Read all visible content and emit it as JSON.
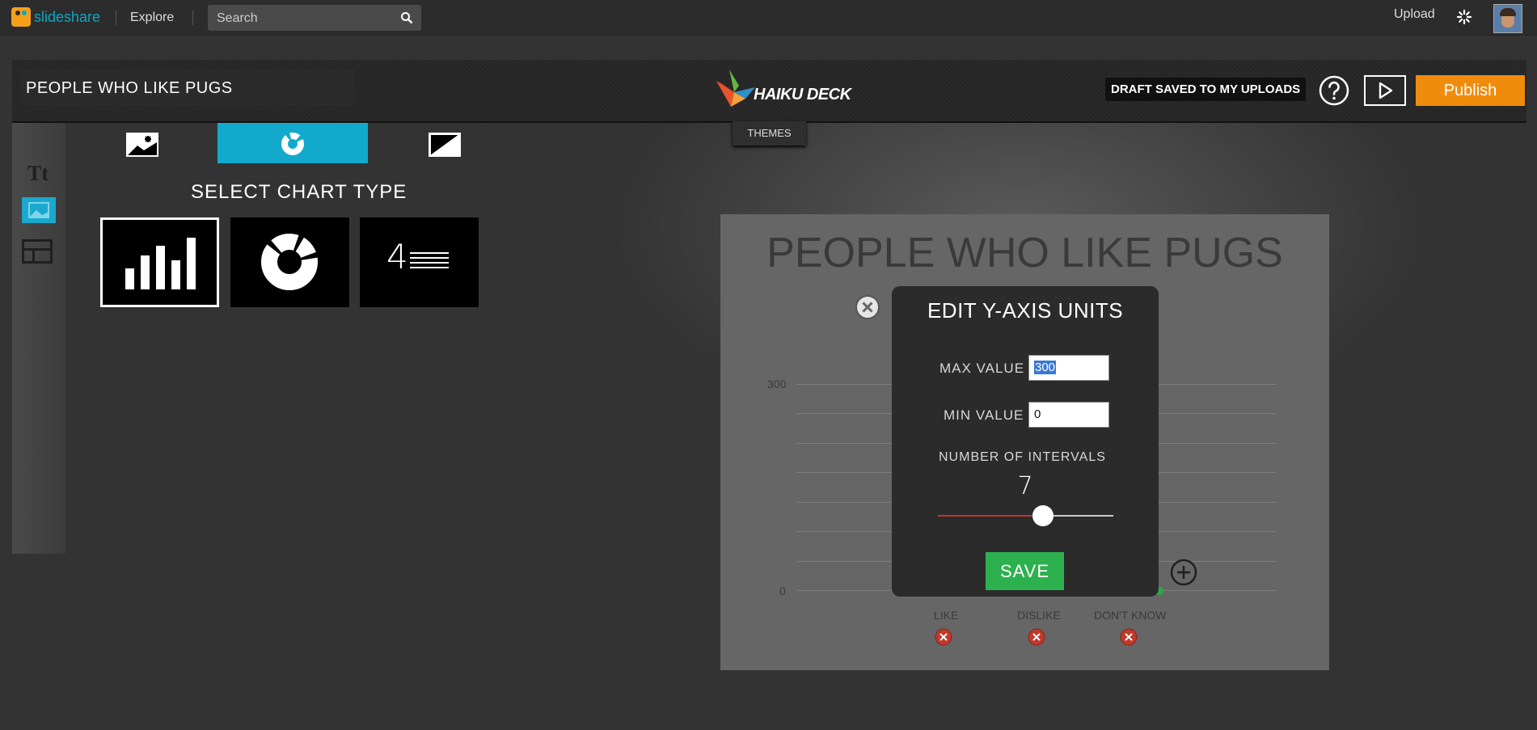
{
  "topbar": {
    "logo_text": "slideshare",
    "explore_label": "Explore",
    "search_placeholder": "Search",
    "upload_label": "Upload",
    "icons": [
      "slideshare-logo-icon",
      "search-icon",
      "spinner-icon",
      "avatar"
    ]
  },
  "deck": {
    "title": "PEOPLE WHO LIKE PUGS",
    "logo_text": "HAIKU DECK",
    "draft_status": "DRAFT SAVED TO MY UPLOADS",
    "publish_label": "Publish",
    "themes_label": "THEMES"
  },
  "rail": {
    "text_tool_label": "Tt",
    "icons": [
      "text-tool-icon",
      "image-tool-icon",
      "layout-tool-icon"
    ]
  },
  "panel": {
    "tabs": [
      "image-tab-icon",
      "chart-tab-icon",
      "solid-color-tab-icon"
    ],
    "active_tab": "chart",
    "heading": "SELECT CHART TYPE",
    "chart_types": [
      {
        "name": "bar",
        "selected": true
      },
      {
        "name": "donut",
        "selected": false
      },
      {
        "name": "stat",
        "number": "4",
        "selected": false
      }
    ]
  },
  "slide": {
    "title": "PEOPLE WHO LIKE PUGS",
    "y_max_tick": "300",
    "y_min_tick": "0",
    "categories": [
      "LIKE",
      "DISLIKE",
      "DON'T KNOW"
    ]
  },
  "modal": {
    "title": "EDIT Y-AXIS UNITS",
    "max_label": "MAX VALUE",
    "max_value": "300",
    "min_label": "MIN VALUE",
    "min_value": "0",
    "intervals_label": "NUMBER OF INTERVALS",
    "intervals_value": "7",
    "intervals_fraction": 0.6,
    "save_label": "SAVE"
  },
  "colors": {
    "accent": "#12a9cd",
    "publish": "#f08c0c",
    "save": "#2db14e",
    "slider_fill": "#c0392b",
    "delete": "#c0392b"
  }
}
